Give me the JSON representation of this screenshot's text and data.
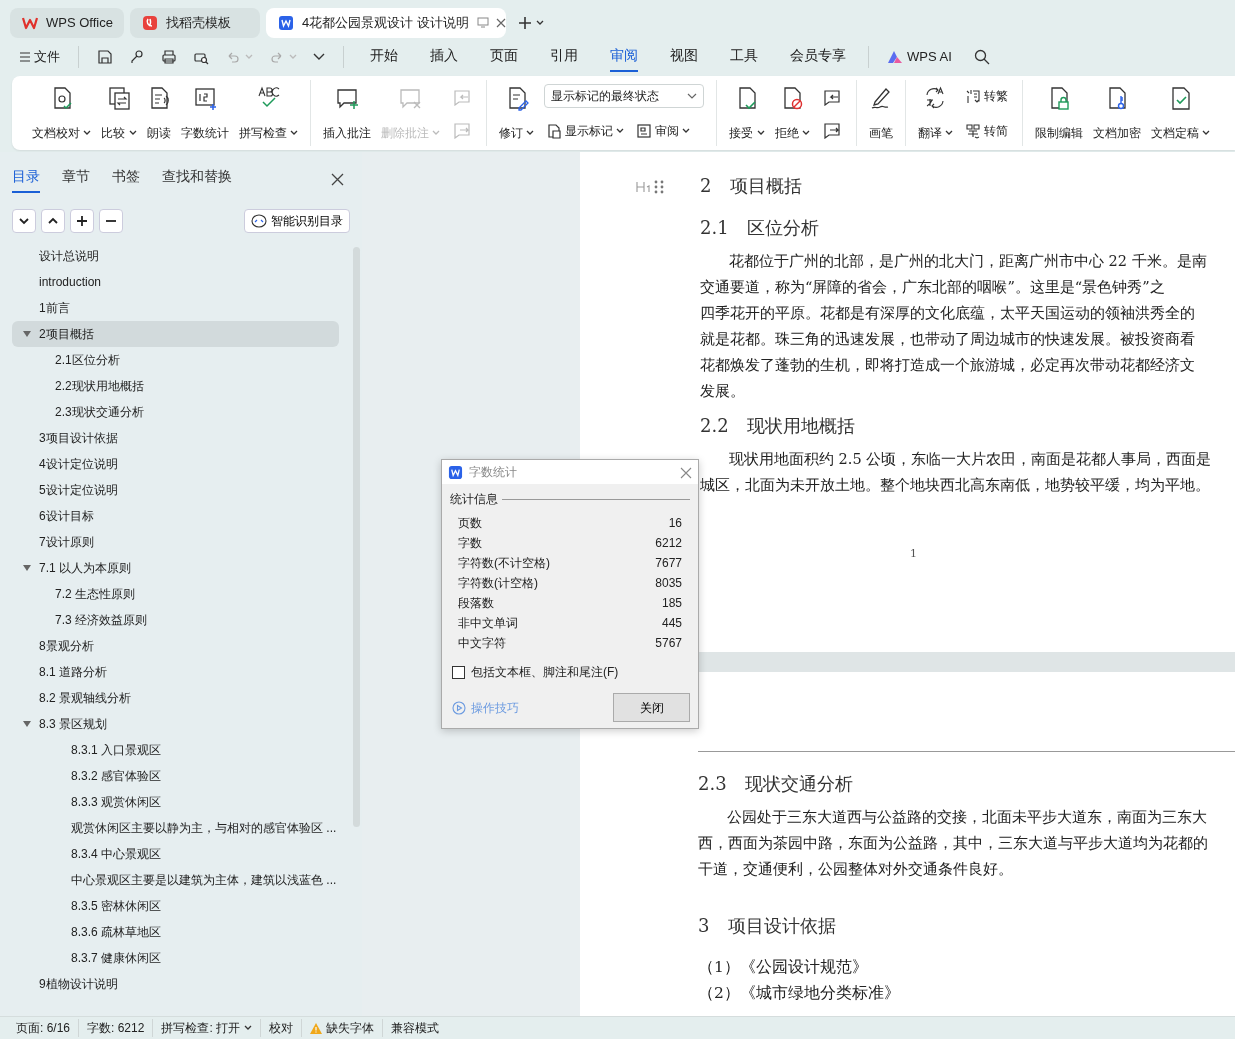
{
  "title_tabs": [
    {
      "label": "WPS Office",
      "selected": false
    },
    {
      "label": "找稻壳模板",
      "selected": false
    },
    {
      "label": "4花都公园景观设计 设计说明",
      "selected": true
    }
  ],
  "menu": {
    "file": "文件",
    "ai": "WPS AI",
    "tabs": [
      {
        "label": "开始",
        "selected": false
      },
      {
        "label": "插入",
        "selected": false
      },
      {
        "label": "页面",
        "selected": false
      },
      {
        "label": "引用",
        "selected": false
      },
      {
        "label": "审阅",
        "selected": true
      },
      {
        "label": "视图",
        "selected": false
      },
      {
        "label": "工具",
        "selected": false
      },
      {
        "label": "会员专享",
        "selected": false
      }
    ]
  },
  "ribbon": {
    "groups": [
      {
        "tools": [
          {
            "kind": "large",
            "label": "文档校对",
            "dropdown": true,
            "disabled": false
          },
          {
            "kind": "large",
            "label": "比较",
            "dropdown": true,
            "disabled": false
          },
          {
            "kind": "large",
            "label": "朗读",
            "dropdown": false,
            "disabled": false
          },
          {
            "kind": "large",
            "label": "字数统计",
            "dropdown": false,
            "disabled": false
          },
          {
            "kind": "large",
            "label": "拼写检查",
            "dropdown": true,
            "disabled": false
          }
        ]
      },
      {
        "tools": [
          {
            "kind": "large",
            "label": "插入批注",
            "dropdown": false,
            "disabled": false
          },
          {
            "kind": "large",
            "label": "删除批注",
            "dropdown": true,
            "disabled": true
          },
          {
            "kind": "pair",
            "disabled": true
          }
        ]
      },
      {
        "tools": [
          {
            "kind": "large",
            "label": "修订",
            "dropdown": true,
            "disabled": false
          },
          {
            "kind": "column",
            "rows": [
              [
                {
                  "kind": "select",
                  "label": "显示标记的最终状态"
                }
              ],
              [
                {
                  "kind": "small",
                  "label": "显示标记",
                  "dropdown": true
                },
                {
                  "kind": "small",
                  "label": "审阅",
                  "dropdown": true
                }
              ]
            ]
          }
        ]
      },
      {
        "tools": [
          {
            "kind": "large",
            "label": "接受",
            "dropdown": true,
            "disabled": false
          },
          {
            "kind": "large",
            "label": "拒绝",
            "dropdown": true,
            "disabled": false
          },
          {
            "kind": "pair",
            "disabled": false
          }
        ]
      },
      {
        "tools": [
          {
            "kind": "large",
            "label": "画笔",
            "dropdown": false,
            "disabled": false
          }
        ]
      },
      {
        "tools": [
          {
            "kind": "large",
            "label": "翻译",
            "dropdown": true,
            "disabled": false
          },
          {
            "kind": "column",
            "rows": [
              [
                {
                  "kind": "small",
                  "label": "转繁",
                  "dropdown": false
                }
              ],
              [
                {
                  "kind": "small",
                  "label": "转简",
                  "dropdown": false
                }
              ]
            ]
          }
        ]
      },
      {
        "tools": [
          {
            "kind": "large",
            "label": "限制编辑",
            "dropdown": false,
            "disabled": false
          },
          {
            "kind": "large",
            "label": "文档加密",
            "dropdown": false,
            "disabled": false
          },
          {
            "kind": "large",
            "label": "文档定稿",
            "dropdown": true,
            "disabled": false
          }
        ]
      }
    ]
  },
  "nav_panel": {
    "tabs": [
      {
        "label": "目录",
        "selected": true
      },
      {
        "label": "章节",
        "selected": false
      },
      {
        "label": "书签",
        "selected": false
      },
      {
        "label": "查找和替换",
        "selected": false
      }
    ],
    "smart_toc": "智能识别目录",
    "toc": [
      {
        "label": "设计总说明",
        "selected": false
      },
      {
        "label": "introduction",
        "selected": false
      },
      {
        "label": "1前言",
        "selected": false
      },
      {
        "label": "2项目概括",
        "selected": true,
        "expanded": true,
        "children": [
          {
            "label": "2.1区位分析",
            "selected": false
          },
          {
            "label": "2.2现状用地概括",
            "selected": false
          },
          {
            "label": "2.3现状交通分析",
            "selected": false
          }
        ]
      },
      {
        "label": "3项目设计依据",
        "selected": false
      },
      {
        "label": "4设计定位说明",
        "selected": false
      },
      {
        "label": "5设计定位说明",
        "selected": false
      },
      {
        "label": "6设计目标",
        "selected": false
      },
      {
        "label": "7设计原则",
        "selected": false
      },
      {
        "label": "7.1 以人为本原则",
        "selected": false,
        "expanded": true,
        "children": [
          {
            "label": "7.2 生态性原则",
            "selected": false
          },
          {
            "label": "7.3 经济效益原则",
            "selected": false
          }
        ]
      },
      {
        "label": "8景观分析",
        "selected": false
      },
      {
        "label": "8.1 道路分析",
        "selected": false
      },
      {
        "label": "8.2 景观轴线分析",
        "selected": false
      },
      {
        "label": "8.3 景区规划",
        "selected": false,
        "expanded": true,
        "children": [
          {
            "label": "8.3.1 入口景观区",
            "selected": false
          },
          {
            "label": "8.3.2 感官体验区",
            "selected": false
          },
          {
            "label": "8.3.3 观赏休闲区",
            "selected": false
          },
          {
            "label": "观赏休闲区主要以静为主，与相对的感官体验区 ...",
            "selected": false
          },
          {
            "label": "8.3.4 中心景观区",
            "selected": false
          },
          {
            "label": "中心景观区主要是以建筑为主体，建筑以浅蓝色 ...",
            "selected": false
          },
          {
            "label": "8.3.5 密林休闲区",
            "selected": false
          },
          {
            "label": "8.3.6 疏林草地区",
            "selected": false
          },
          {
            "label": "8.3.7 健康休闲区",
            "selected": false
          }
        ]
      },
      {
        "label": "9植物设计说明",
        "selected": false
      }
    ]
  },
  "document": {
    "pages": [
      {
        "blocks": [
          {
            "kind": "h1",
            "text": "2 项目概括"
          },
          {
            "kind": "h2",
            "text": "2.1 区位分析"
          },
          {
            "kind": "para",
            "lines": [
              "花都位于广州的北部，是广州的北大门，距离广州市中心 22 千米。是南",
              "交通要道，称为“屏障的省会，广东北部的咽喉”。这里是“景色钟秀”之",
              "四季花开的平原。花都是有深厚的文化底蕴，太平天国运动的领袖洪秀全的",
              "就是花都。珠三角的迅速发展，也带动了周边城市的快速发展。被投资商看",
              "花都焕发了蓬勃的生机，即将打造成一个旅游城，必定再次带动花都经济文",
              "发展。"
            ]
          },
          {
            "kind": "h2",
            "text": "2.2 现状用地概括"
          },
          {
            "kind": "para",
            "lines": [
              "现状用地面积约 2.5 公顷，东临一大片农田，南面是花都人事局，西面是",
              "城区，北面为未开放土地。整个地块西北高东南低，地势较平缓，均为平地。"
            ]
          }
        ],
        "page_number": "1"
      },
      {
        "blocks": [
          {
            "kind": "h2",
            "text": "2.3 现状交通分析"
          },
          {
            "kind": "para",
            "lines": [
              "公园处于三东大道西与公益路的交接，北面未平步大道东，南面为三东大",
              "西，西面为茶园中路，东面为公益路，其中，三东大道与平步大道均为花都的",
              "干道，交通便利，公园整体对外交通条件良好。"
            ]
          },
          {
            "kind": "h1",
            "text": "3 项目设计依据"
          },
          {
            "kind": "list",
            "lines": [
              "（1）《公园设计规范》",
              "（2）《城市绿地分类标准》"
            ]
          }
        ]
      }
    ]
  },
  "word_count_dialog": {
    "title": "字数统计",
    "section": "统计信息",
    "rows": [
      {
        "label": "页数",
        "value": "16"
      },
      {
        "label": "字数",
        "value": "6212"
      },
      {
        "label": "字符数(不计空格)",
        "value": "7677"
      },
      {
        "label": "字符数(计空格)",
        "value": "8035"
      },
      {
        "label": "段落数",
        "value": "185"
      },
      {
        "label": "非中文单词",
        "value": "445"
      },
      {
        "label": "中文字符",
        "value": "5767"
      }
    ],
    "checkbox": {
      "label": "包括文本框、脚注和尾注(F)",
      "checked": false
    },
    "tips": "操作技巧",
    "close": "关闭"
  },
  "status_bar": {
    "items": [
      {
        "kind": "text",
        "label": "页面: 6/16"
      },
      {
        "kind": "text",
        "label": "字数: 6212"
      },
      {
        "kind": "dropdown",
        "label": "拼写检查: 打开"
      },
      {
        "kind": "text",
        "label": "校对"
      },
      {
        "kind": "warning",
        "label": "缺失字体"
      },
      {
        "kind": "text",
        "label": "兼容模式"
      }
    ]
  }
}
